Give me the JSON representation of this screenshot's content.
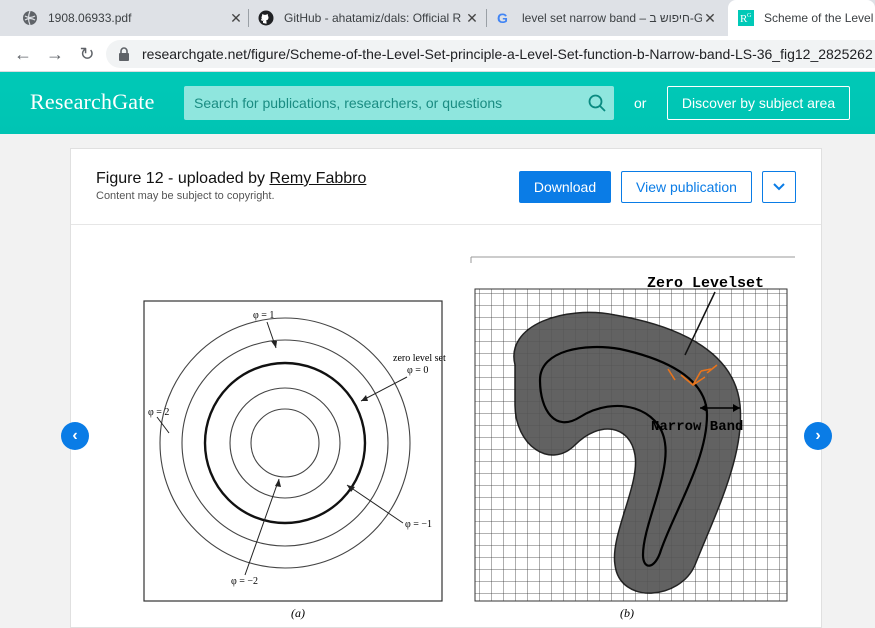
{
  "browser": {
    "tabs": [
      {
        "title": "1908.06933.pdf",
        "icon": "globe-icon"
      },
      {
        "title": "GitHub - ahatamiz/dals: Official R",
        "icon": "github-icon"
      },
      {
        "title": "level set narrow band – חיפוש ב-Go",
        "icon": "google-icon"
      },
      {
        "title": "Scheme of the Level S",
        "icon": "researchgate-icon"
      }
    ],
    "url": "researchgate.net/figure/Scheme-of-the-Level-Set-principle-a-Level-Set-function-b-Narrow-band-LS-36_fig12_2825262"
  },
  "header": {
    "logo": "ResearchGate",
    "search_placeholder": "Search for publications, researchers, or questions",
    "or_label": "or",
    "discover_label": "Discover by subject area",
    "accent_color": "#00c9b7"
  },
  "figure": {
    "title_prefix": "Figure 12 - uploaded by ",
    "uploader": "Remy Fabbro",
    "note": "Content may be subject to copyright.",
    "download_label": "Download",
    "view_label": "View publication",
    "panel_a": {
      "phi1": "φ = 1",
      "phi2": "φ = 2",
      "zero_label_1": "zero level set",
      "zero_label_2": "φ = 0",
      "phim1": "φ = −1",
      "phim2": "φ = −2",
      "caption": "(a)"
    },
    "panel_b": {
      "zero_levelset": "Zero Levelset",
      "narrow_band": "Narrow Band",
      "caption": "(b)"
    }
  },
  "nav": {
    "prev": "‹",
    "next": "›"
  },
  "colors": {
    "primary_blue": "#0a7ce6"
  }
}
